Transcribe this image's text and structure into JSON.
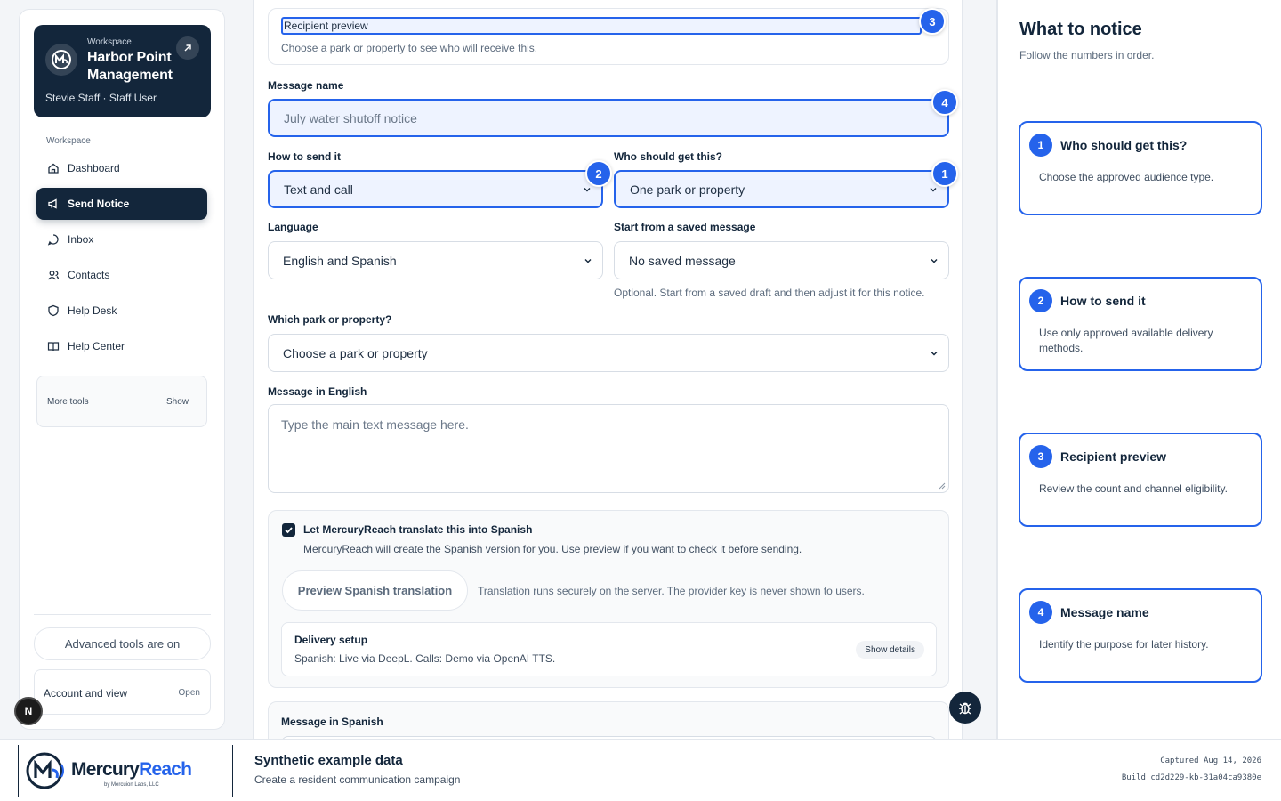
{
  "workspace": {
    "eyebrow": "Workspace",
    "name": "Harbor Point Management",
    "user": "Stevie Staff · Staff User"
  },
  "nav": {
    "heading": "Workspace",
    "items": [
      {
        "label": "Dashboard",
        "icon": "home-icon"
      },
      {
        "label": "Send Notice",
        "icon": "megaphone-icon",
        "active": true
      },
      {
        "label": "Inbox",
        "icon": "chat-icon"
      },
      {
        "label": "Contacts",
        "icon": "users-icon"
      },
      {
        "label": "Help Desk",
        "icon": "shield-icon"
      },
      {
        "label": "Help Center",
        "icon": "book-icon"
      }
    ]
  },
  "more_tools": {
    "label": "More tools",
    "action": "Show"
  },
  "advanced_tools": "Advanced tools are on",
  "account": {
    "label": "Account and view",
    "action": "Open"
  },
  "n_badge": "N",
  "form": {
    "preview_title": "Recipient preview",
    "preview_sub": "Choose a park or property to see who will receive this.",
    "message_name_label": "Message name",
    "message_name_placeholder": "July water shutoff notice",
    "how_label": "How to send it",
    "how_value": "Text and call",
    "who_label": "Who should get this?",
    "who_value": "One park or property",
    "language_label": "Language",
    "language_value": "English and Spanish",
    "saved_label": "Start from a saved message",
    "saved_value": "No saved message",
    "saved_help": "Optional. Start from a saved draft and then adjust it for this notice.",
    "park_label": "Which park or property?",
    "park_value": "Choose a park or property",
    "english_label": "Message in English",
    "english_placeholder": "Type the main text message here.",
    "translate_label": "Let MercuryReach translate this into Spanish",
    "translate_desc": "MercuryReach will create the Spanish version for you. Use preview if you want to check it before sending.",
    "translate_checked": true,
    "preview_btn": "Preview Spanish translation",
    "translate_note": "Translation runs securely on the server. The provider key is never shown to users.",
    "setup_title": "Delivery setup",
    "setup_desc": "Spanish: Live via DeepL. Calls: Demo via OpenAI TTS.",
    "setup_btn": "Show details",
    "spanish_label": "Message in Spanish"
  },
  "markers": {
    "preview": "3",
    "name": "4",
    "how": "2",
    "who": "1"
  },
  "guide": {
    "title": "What to notice",
    "subtitle": "Follow the numbers in order.",
    "steps": [
      {
        "num": "1",
        "title": "Who should get this?",
        "desc": "Choose the approved audience type."
      },
      {
        "num": "2",
        "title": "How to send it",
        "desc": "Use only approved available delivery methods."
      },
      {
        "num": "3",
        "title": "Recipient preview",
        "desc": "Review the count and channel eligibility."
      },
      {
        "num": "4",
        "title": "Message name",
        "desc": "Identify the purpose for later history."
      }
    ]
  },
  "footer": {
    "brand_a": "Mercury",
    "brand_b": "Reach",
    "by": "by Mercuion Labs, LLC",
    "title": "Synthetic example data",
    "subtitle": "Create a resident communication campaign",
    "captured": "Captured Aug 14, 2026",
    "build": "Build cd2d229-kb-31a04ca9380e"
  },
  "colors": {
    "navy": "#13263b",
    "accent": "#2563eb",
    "highlight_bg": "#eef3ff"
  }
}
